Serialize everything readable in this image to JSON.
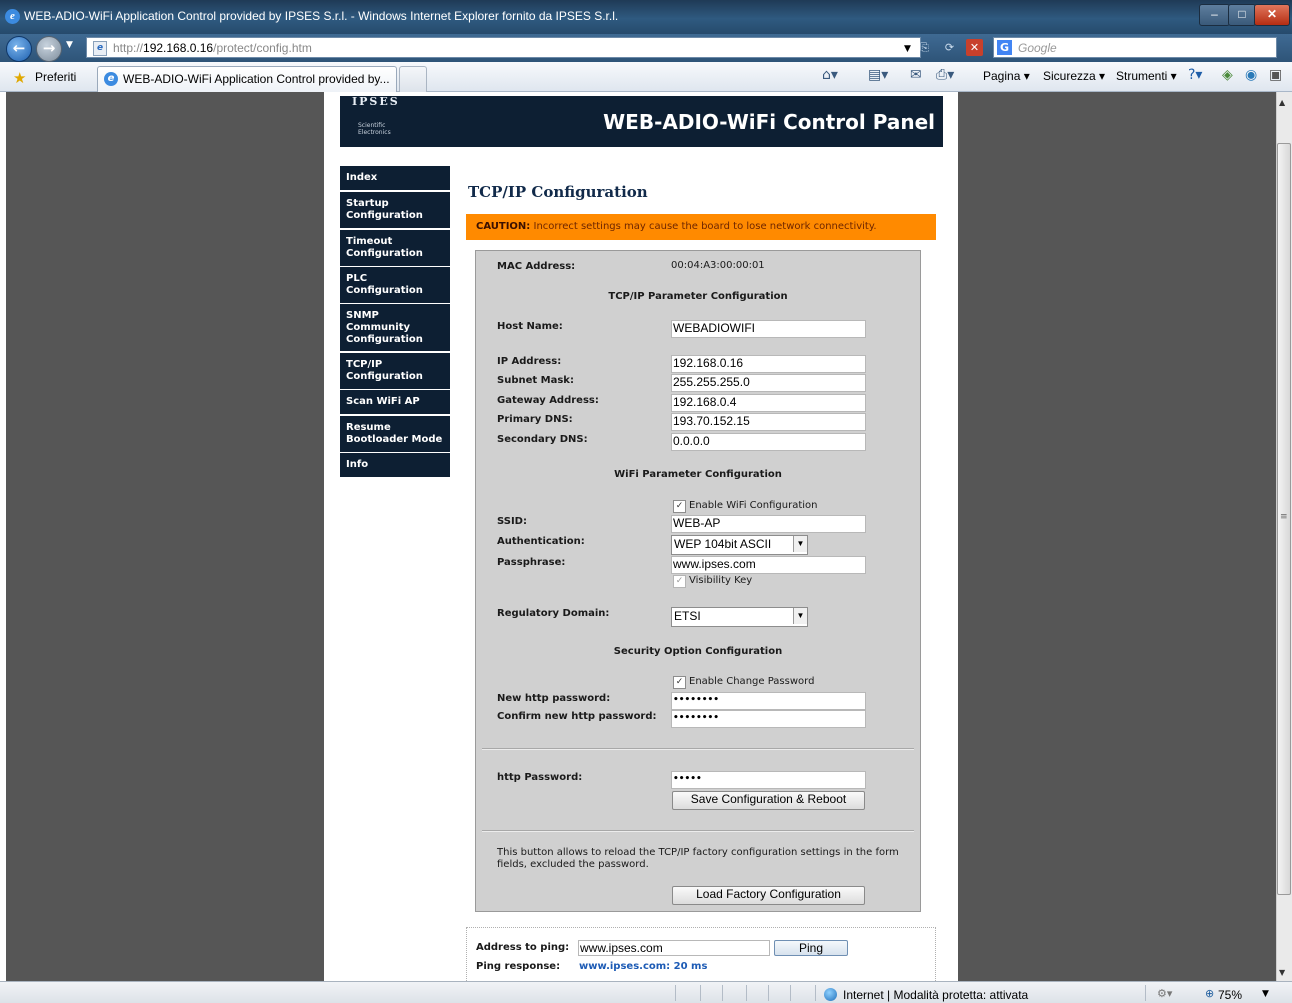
{
  "window": {
    "title": "WEB-ADIO-WiFi Application Control provided by IPSES S.r.l. - Windows Internet Explorer fornito da IPSES S.r.l.",
    "minimize": "–",
    "maximize": "□",
    "close": "✕"
  },
  "address_bar": {
    "prefix": "http://",
    "host": "192.168.0.16",
    "path": "/protect/config.htm",
    "search_placeholder": "Google"
  },
  "favorites": {
    "label": "Preferiti",
    "tab_label": "WEB-ADIO-WiFi Application Control provided by..."
  },
  "commands": {
    "pagina": "Pagina ▾",
    "sicurezza": "Sicurezza ▾",
    "strumenti": "Strumenti ▾"
  },
  "banner": {
    "logo_text": "IPSES",
    "logo_sub1": "Scientific",
    "logo_sub2": "Electronics",
    "title": "WEB-ADIO-WiFi Control Panel"
  },
  "sidebar": {
    "items": [
      {
        "label": "Index"
      },
      {
        "label": "Startup Configuration"
      },
      {
        "label": "Timeout Configuration"
      },
      {
        "label": "PLC Configuration"
      },
      {
        "label": "SNMP Community Configuration"
      },
      {
        "label": "TCP/IP Configuration"
      },
      {
        "label": "Scan WiFi AP"
      },
      {
        "label": "Resume Bootloader Mode"
      },
      {
        "label": "Info"
      }
    ]
  },
  "main": {
    "heading": "TCP/IP Configuration",
    "caution_label": "CAUTION:",
    "caution_text": " Incorrect settings may cause the board to lose network connectivity.",
    "mac_label": "MAC Address:",
    "mac_value": "00:04:A3:00:00:01",
    "tcpip_section": "TCP/IP Parameter Configuration",
    "host_label": "Host Name:",
    "host_value": "WEBADIOWIFI",
    "ip_label": "IP Address:",
    "ip_value": "192.168.0.16",
    "subnet_label": "Subnet Mask:",
    "subnet_value": "255.255.255.0",
    "gateway_label": "Gateway Address:",
    "gateway_value": "192.168.0.4",
    "dns1_label": "Primary DNS:",
    "dns1_value": "193.70.152.15",
    "dns2_label": "Secondary DNS:",
    "dns2_value": "0.0.0.0",
    "wifi_section": "WiFi Parameter Configuration",
    "enable_wifi_label": "Enable WiFi Configuration",
    "enable_wifi_checked": true,
    "ssid_label": "SSID:",
    "ssid_value": "WEB-AP",
    "auth_label": "Authentication:",
    "auth_value": "WEP 104bit ASCII",
    "pass_label": "Passphrase:",
    "pass_value": "www.ipses.com",
    "visibility_label": "Visibility Key",
    "visibility_checked": true,
    "domain_label": "Regulatory Domain:",
    "domain_value": "ETSI",
    "security_section": "Security Option Configuration",
    "enable_pw_label": "Enable Change Password",
    "enable_pw_checked": true,
    "newpw_label": "New http password:",
    "newpw_value": "••••••••",
    "confirmpw_label": "Confirm new http password:",
    "confirmpw_value": "••••••••",
    "httppw_label": "http Password:",
    "httppw_value": "•••••",
    "save_button": "Save Configuration & Reboot",
    "factory_note": "This button allows to reload the TCP/IP factory configuration settings in the form fields, excluded the password.",
    "factory_button": "Load Factory Configuration"
  },
  "ping": {
    "label": "Address to ping:",
    "value": "www.ipses.com",
    "button": "Ping",
    "response_label": "Ping response:",
    "response_value": "www.ipses.com: 20 ms"
  },
  "status": {
    "text": "Internet | Modalità protetta: attivata",
    "zoom": "75%"
  }
}
